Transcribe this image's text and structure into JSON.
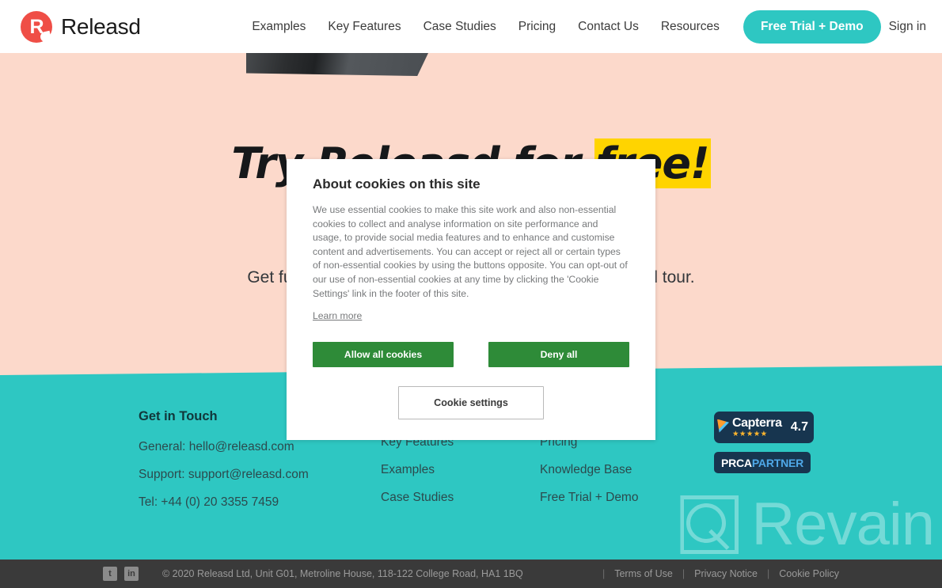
{
  "header": {
    "brand_name": "Releasd",
    "logo_letter": "R",
    "nav_items": [
      {
        "label": "Examples"
      },
      {
        "label": "Key Features"
      },
      {
        "label": "Case Studies"
      },
      {
        "label": "Pricing"
      },
      {
        "label": "Contact Us"
      },
      {
        "label": "Resources"
      }
    ],
    "cta_label": "Free Trial + Demo",
    "signin_label": "Sign in",
    "cta_color": "#2ec7c2"
  },
  "hero": {
    "heading_prefix": "Try Releasd for ",
    "heading_highlight": "free!",
    "subheading_left": "Get ful",
    "subheading_right": "ded tour.",
    "background_color": "#fcd9cb",
    "highlight_color": "#ffd400"
  },
  "cookie_dialog": {
    "title": "About cookies on this site",
    "body": "We use essential cookies to make this site work and also non-essential cookies to collect and analyse information on site performance and usage, to provide social media features and to enhance and customise content and advertisements. You can accept or reject all or certain types of non-essential cookies by using the buttons opposite. You can opt-out of our use of non-essential cookies at any time by clicking the 'Cookie Settings' link in the footer of this site.",
    "learn_more_label": "Learn more",
    "allow_label": "Allow all cookies",
    "deny_label": "Deny all",
    "settings_label": "Cookie settings",
    "button_color": "#2e8b38"
  },
  "footer": {
    "background_color": "#2ec7c2",
    "contact": {
      "title": "Get in Touch",
      "lines": [
        "General: hello@releasd.com",
        "Support: support@releasd.com",
        "Tel: +44 (0) 20 3355 7459"
      ]
    },
    "links_col_1": [
      {
        "label": "Key Features"
      },
      {
        "label": "Examples"
      },
      {
        "label": "Case Studies"
      }
    ],
    "links_col_2": [
      {
        "label": "Pricing"
      },
      {
        "label": "Knowledge Base"
      },
      {
        "label": "Free Trial + Demo"
      }
    ],
    "badges": {
      "capterra_name": "Capterra",
      "capterra_score": "4.7",
      "capterra_stars": "★★★★★",
      "prca_bold": "PRCA",
      "prca_light": "PARTNER"
    },
    "watermark_text": "Revain"
  },
  "bottom_bar": {
    "social": [
      {
        "name": "twitter",
        "glyph": "t"
      },
      {
        "name": "linkedin",
        "glyph": "in"
      }
    ],
    "copyright": "© 2020 Releasd Ltd, Unit G01, Metroline House, 118-122 College Road, HA1 1BQ",
    "legal_links": [
      {
        "label": "Terms of Use"
      },
      {
        "label": "Privacy Notice"
      },
      {
        "label": "Cookie Policy"
      }
    ],
    "separator": "|"
  }
}
